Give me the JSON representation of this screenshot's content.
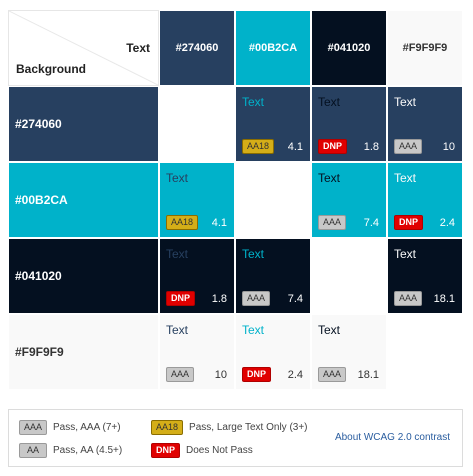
{
  "corner": {
    "text_label": "Text",
    "background_label": "Background"
  },
  "colors": [
    {
      "hex": "#274060",
      "label": "#274060",
      "fg_head": "#ffffff"
    },
    {
      "hex": "#00B2CA",
      "label": "#00B2CA",
      "fg_head": "#ffffff"
    },
    {
      "hex": "#041020",
      "label": "#041020",
      "fg_head": "#ffffff"
    },
    {
      "hex": "#F9F9F9",
      "label": "#F9F9F9",
      "fg_head": "#333333"
    }
  ],
  "sample_text": "Text",
  "cells": [
    [
      null,
      {
        "badge": "AA18",
        "ratio": "4.1"
      },
      {
        "badge": "DNP",
        "ratio": "1.8"
      },
      {
        "badge": "AAA",
        "ratio": "10"
      }
    ],
    [
      {
        "badge": "AA18",
        "ratio": "4.1"
      },
      null,
      {
        "badge": "AAA",
        "ratio": "7.4"
      },
      {
        "badge": "DNP",
        "ratio": "2.4"
      }
    ],
    [
      {
        "badge": "DNP",
        "ratio": "1.8"
      },
      {
        "badge": "AAA",
        "ratio": "7.4"
      },
      null,
      {
        "badge": "AAA",
        "ratio": "18.1"
      }
    ],
    [
      {
        "badge": "AAA",
        "ratio": "10"
      },
      {
        "badge": "DNP",
        "ratio": "2.4"
      },
      {
        "badge": "AAA",
        "ratio": "18.1"
      },
      null
    ]
  ],
  "legend": {
    "aaa": {
      "badge": "AAA",
      "text": "Pass, AAA (7+)"
    },
    "aa": {
      "badge": "AA",
      "text": "Pass, AA (4.5+)"
    },
    "aa18": {
      "badge": "AA18",
      "text": "Pass, Large Text Only (3+)"
    },
    "dnp": {
      "badge": "DNP",
      "text": "Does Not Pass"
    },
    "link": "About WCAG 2.0 contrast"
  }
}
